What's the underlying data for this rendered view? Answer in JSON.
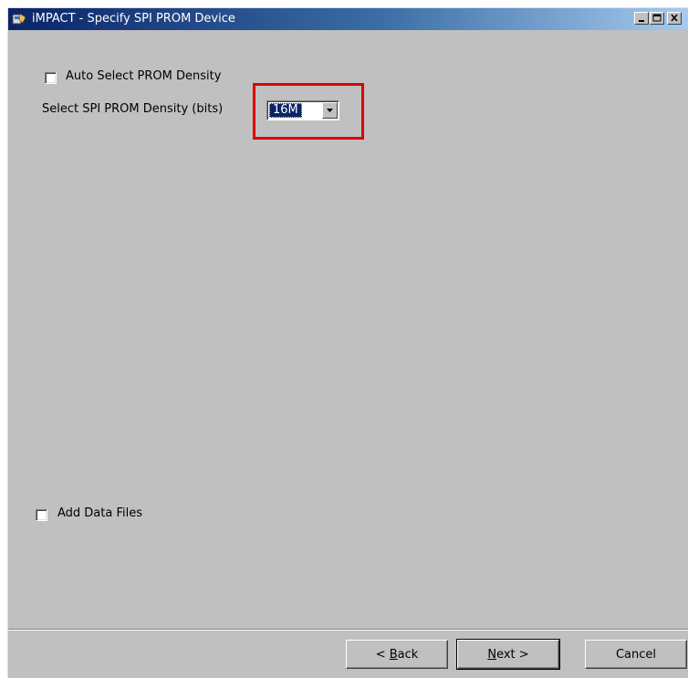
{
  "window": {
    "title": "iMPACT - Specify SPI PROM Device"
  },
  "form": {
    "auto_select_label": "Auto Select PROM Density",
    "auto_select_checked": false,
    "density_label": "Select SPI PROM Density (bits)",
    "density_value": "16M",
    "add_data_files_label": "Add Data Files",
    "add_data_files_checked": false
  },
  "footer": {
    "back_mnemonic": "B",
    "back_rest": "ack",
    "back_prefix": "< ",
    "next_mnemonic": "N",
    "next_rest": "ext >",
    "cancel_label": "Cancel"
  },
  "colors": {
    "titlebar_start": "#0a246a",
    "highlight": "#e00000",
    "face": "#c0c0c0"
  }
}
